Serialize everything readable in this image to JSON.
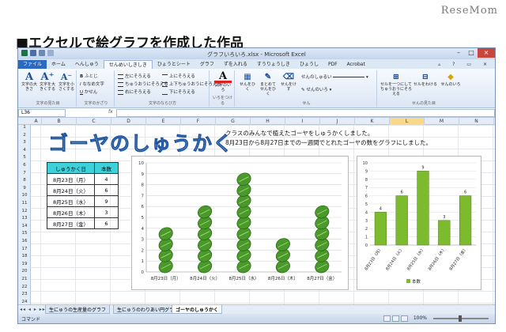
{
  "brand": "ReseMom",
  "caption": "■エクセルで絵グラフを作成した作品",
  "window": {
    "title": "グラフいろいろ.xlsx - Microsoft Excel",
    "controls": [
      "–",
      "□",
      "×"
    ]
  },
  "tabs": [
    "ファイル",
    "ホーム",
    "へんしゅう",
    "せんめいしきしき",
    "ひょうとシート",
    "グラフ",
    "ずを入れる",
    "すうりょうしき",
    "ひょうし",
    "PDF",
    "Acrobat"
  ],
  "active_tab_index": 3,
  "ribbon": {
    "group1": {
      "label": "文字の見た目",
      "buttons": [
        "文字の大きさ",
        "文字を大きくする",
        "文字を小さくする"
      ]
    },
    "group2": {
      "label": "文字のかざり",
      "rows": [
        "ふとじ",
        "ななめ文字",
        "かせん"
      ]
    },
    "group3": {
      "label": "文字のならび方",
      "rows": [
        "左にそろえる",
        "ちゅうおうにそろえる",
        "右にそろえる",
        "上にそろえる",
        "上下ちゅうおうにそろえる",
        "下にそろえる"
      ]
    },
    "group4": {
      "label": "いろをつける",
      "button": "文字のいろ"
    },
    "group5": {
      "label": "せん",
      "buttons": [
        "せんをひく",
        "まとめてせんをひく",
        "せんをけす"
      ],
      "rows": [
        "せんのしゅるい",
        "せんのいろ"
      ]
    },
    "group6": {
      "label": "せんの見た目",
      "buttons": [
        "セルを一つにしてちゅうおうにそろえる",
        "セルをわける",
        "せんのいろ"
      ]
    }
  },
  "formula_bar": {
    "name_box": "L36",
    "fx": "fx",
    "value": ""
  },
  "columns": [
    "A",
    "B",
    "C",
    "D",
    "E",
    "F",
    "G",
    "H",
    "I",
    "J",
    "K",
    "L",
    "M",
    "N",
    "O",
    "P",
    "Q"
  ],
  "selected_column": "L",
  "rows": [
    "1",
    "2",
    "3",
    "4",
    "5",
    "6",
    "7",
    "8",
    "9",
    "10",
    "11",
    "12",
    "13",
    "14",
    "15",
    "16",
    "17",
    "18",
    "19",
    "20",
    "21",
    "22",
    "23",
    "24"
  ],
  "sheet_title": "ゴーヤのしゅうかく",
  "description": [
    "クラスのみんなで植えたゴーヤをしゅうかくしました。",
    "8月23日から8月27日までの一週間でとれたゴーヤの数をグラフにしました。"
  ],
  "table": {
    "headers": [
      "しゅうかく日",
      "本数"
    ],
    "rows": [
      [
        "8月23日（月）",
        "4"
      ],
      [
        "8月24日（火）",
        "6"
      ],
      [
        "8月25日（水）",
        "9"
      ],
      [
        "8月26日（木）",
        "3"
      ],
      [
        "8月27日（金）",
        "6"
      ]
    ]
  },
  "chart_data": [
    {
      "type": "bar",
      "title": "",
      "categories": [
        "8月23日（月）",
        "8月24日（火）",
        "8月25日（水）",
        "8月26日（木）",
        "8月27日（金）"
      ],
      "values": [
        4,
        6,
        9,
        3,
        6
      ],
      "ylim": [
        0,
        10
      ],
      "yticks": [
        0,
        1,
        2,
        3,
        4,
        5,
        6,
        7,
        8,
        9,
        10
      ],
      "pictograph": "goya-leaf",
      "grid": true,
      "fill_color": "#4a9a2a"
    },
    {
      "type": "bar",
      "title": "",
      "categories": [
        "8月23日（月）",
        "8月24日（火）",
        "8月25日（水）",
        "8月26日（木）",
        "8月27日（金）"
      ],
      "series": [
        {
          "name": "本数",
          "values": [
            4,
            6,
            9,
            3,
            6
          ]
        }
      ],
      "data_labels": [
        "4",
        "6",
        "9",
        "3",
        "6"
      ],
      "ylim": [
        0,
        10
      ],
      "yticks": [
        0,
        1,
        2,
        3,
        4,
        5,
        6,
        7,
        8,
        9,
        10
      ],
      "legend": "bottom",
      "grid": true,
      "fill_color": "#7dbb2e"
    }
  ],
  "sheet_tabs": [
    "生にゅうの生産量のグラフ",
    "生にゅうのわりあい円グラフ",
    "ゴーヤのしゅうかく"
  ],
  "active_sheet_index": 2,
  "sheet_nav": "◂◂ ◂ ▸ ▸▸",
  "status": {
    "mode": "コマンド",
    "zoom": "100%"
  }
}
